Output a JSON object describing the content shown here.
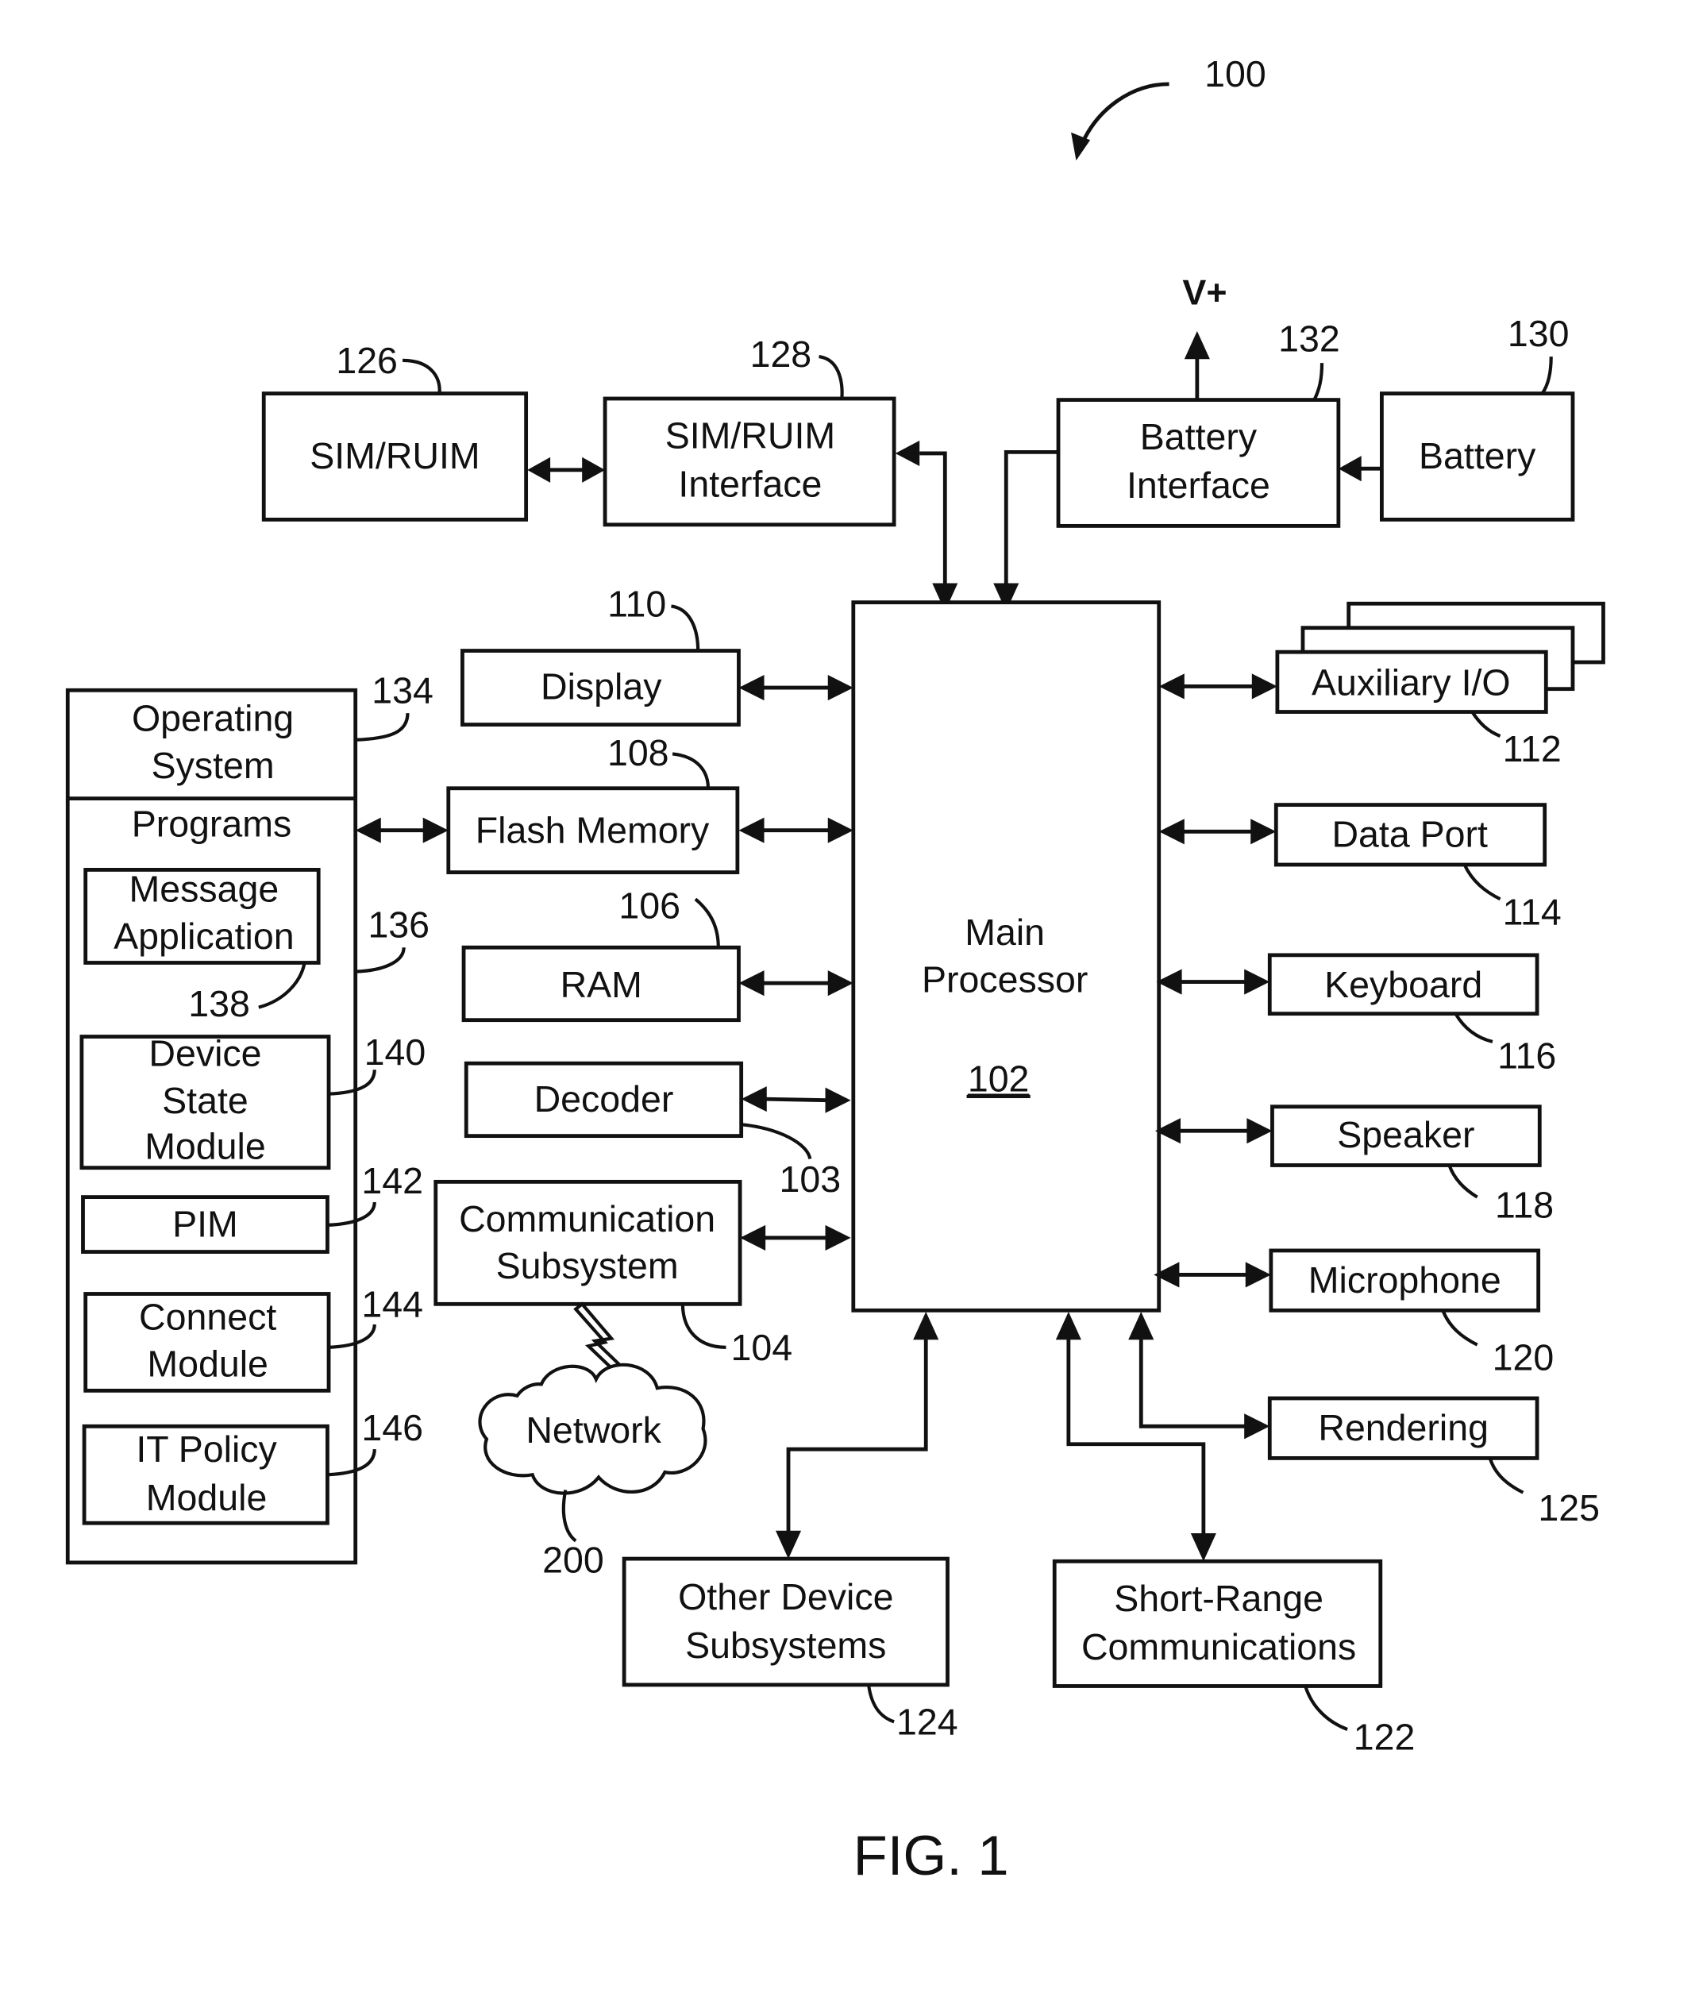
{
  "figure": {
    "caption": "FIG. 1",
    "device_ref": "100"
  },
  "blocks": {
    "sim_ruim": {
      "label": [
        "SIM/RUIM"
      ],
      "ref": "126"
    },
    "sim_ruim_interface": {
      "label": [
        "SIM/RUIM",
        "Interface"
      ],
      "ref": "128"
    },
    "battery_interface": {
      "label": [
        "Battery",
        "Interface"
      ],
      "ref": "132"
    },
    "battery": {
      "label": [
        "Battery"
      ],
      "ref": "130"
    },
    "voltage_out": {
      "label": "V+"
    },
    "main_processor": {
      "label": [
        "Main",
        "Processor"
      ],
      "ref": "102"
    },
    "display": {
      "label": [
        "Display"
      ],
      "ref": "110"
    },
    "flash_memory": {
      "label": [
        "Flash Memory"
      ],
      "ref": "108"
    },
    "ram": {
      "label": [
        "RAM"
      ],
      "ref": "106"
    },
    "decoder": {
      "label": [
        "Decoder"
      ],
      "ref": "103"
    },
    "communication_subsystem": {
      "label": [
        "Communication",
        "Subsystem"
      ],
      "ref": "104"
    },
    "network": {
      "label": [
        "Network"
      ],
      "ref": "200"
    },
    "auxiliary_io": {
      "label": [
        "Auxiliary I/O"
      ],
      "ref": "112"
    },
    "data_port": {
      "label": [
        "Data Port"
      ],
      "ref": "114"
    },
    "keyboard": {
      "label": [
        "Keyboard"
      ],
      "ref": "116"
    },
    "speaker": {
      "label": [
        "Speaker"
      ],
      "ref": "118"
    },
    "microphone": {
      "label": [
        "Microphone"
      ],
      "ref": "120"
    },
    "rendering": {
      "label": [
        "Rendering"
      ],
      "ref": "125"
    },
    "other_device_subsystems": {
      "label": [
        "Other Device",
        "Subsystems"
      ],
      "ref": "124"
    },
    "short_range_communications": {
      "label": [
        "Short-Range",
        "Communications"
      ],
      "ref": "122"
    },
    "operating_system": {
      "label": [
        "Operating",
        "System"
      ],
      "ref": "134"
    },
    "programs": {
      "label": [
        "Programs"
      ],
      "ref": "136"
    },
    "message_application": {
      "label": [
        "Message",
        "Application"
      ],
      "ref": "138"
    },
    "device_state_module": {
      "label": [
        "Device",
        "State",
        "Module"
      ],
      "ref": "140"
    },
    "pim": {
      "label": [
        "PIM"
      ],
      "ref": "142"
    },
    "connect_module": {
      "label": [
        "Connect",
        "Module"
      ],
      "ref": "144"
    },
    "it_policy_module": {
      "label": [
        "IT Policy",
        "Module"
      ],
      "ref": "146"
    }
  }
}
